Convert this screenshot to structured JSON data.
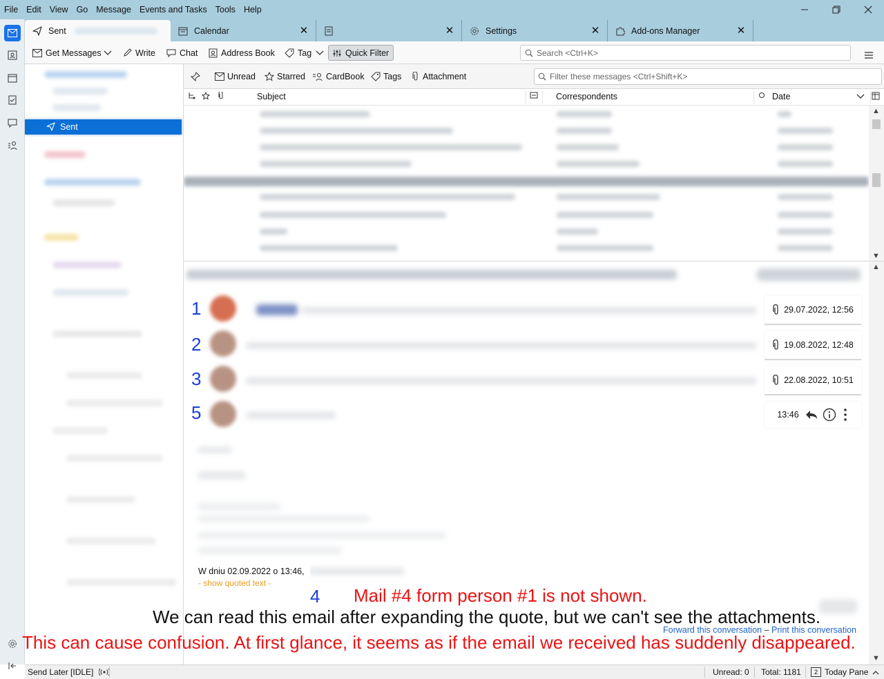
{
  "menu": [
    "File",
    "Edit",
    "View",
    "Go",
    "Message",
    "Events and Tasks",
    "Tools",
    "Help"
  ],
  "tabs": [
    {
      "label": "Sent",
      "icon": "send-icon",
      "active": true
    },
    {
      "label": "Calendar",
      "icon": "calendar-icon"
    },
    {
      "label": "",
      "icon": "document-icon"
    },
    {
      "label": "Settings",
      "icon": "gear-icon"
    },
    {
      "label": "Add-ons Manager",
      "icon": "puzzle-icon"
    }
  ],
  "toolbar": {
    "get_messages": "Get Messages",
    "write": "Write",
    "chat": "Chat",
    "address_book": "Address Book",
    "tag": "Tag",
    "quick_filter": "Quick Filter",
    "search_placeholder": "Search <Ctrl+K>"
  },
  "folder": {
    "selected": "Sent"
  },
  "quickfilter": {
    "unread": "Unread",
    "starred": "Starred",
    "cardbook": "CardBook",
    "tags": "Tags",
    "attachment": "Attachment",
    "filter_placeholder": "Filter these messages <Ctrl+Shift+K>"
  },
  "columns": {
    "subject": "Subject",
    "correspondents": "Correspondents",
    "date": "Date"
  },
  "conversation": {
    "annotations": [
      "1",
      "2",
      "3",
      "5"
    ],
    "dates": [
      "29.07.2022, 12:56",
      "19.08.2022, 12:48",
      "22.08.2022, 10:51"
    ],
    "last_time": "13:46",
    "quote_header": "W dniu 02.09.2022 o 13:46,",
    "show_quoted": "- show quoted text -",
    "forward_link": "Forward this conversation",
    "link_separator": "–",
    "print_link": "Print this conversation"
  },
  "notes": {
    "num4": "4",
    "line1": "Mail #4 form person #1 is not shown.",
    "line2": "We can read this email after expanding the quote, but we can't see the attachments.",
    "line3": "This can cause confusion. At first glance, it seems as if the email we received has suddenly disappeared.",
    "colors": {
      "blue": "#1a3fd6",
      "red": "#e81414",
      "black": "#111111"
    }
  },
  "status": {
    "send_later": "Send Later [IDLE]",
    "unread": "Unread: 0",
    "total": "Total: 1181",
    "today_pane": "Today Pane",
    "today_day": "2"
  }
}
